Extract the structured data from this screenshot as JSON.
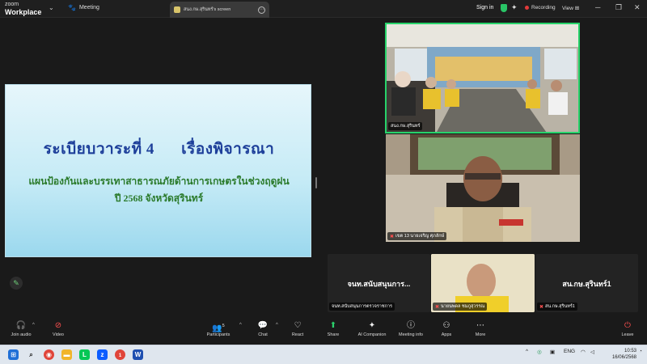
{
  "window": {
    "logo_top": "zoom",
    "logo_bottom": "Workplace",
    "meeting_tab": "Meeting",
    "share_tab": "สนง.กษ.สุรินทร์'s screen",
    "sign_in": "Sign in",
    "recording": "Recording",
    "view": "View",
    "accent": "#27d36a"
  },
  "slide": {
    "title_left": "ระเบียบวาระที่ 4",
    "title_right": "เรื่องพิจารณา",
    "line1": "แผนป้องกันและบรรเทาสาธารณภัยด้านการเกษตรในช่วงฤดูฝน",
    "line2": "ปี 2568  จังหวัดสุรินทร์"
  },
  "videos": {
    "v1_label": "สนง.กษ.สุรินทร์",
    "v2_label": "เขต 13 นายเจริญ ศุภลักษ์",
    "tile1_name": "จนท.สนับสนุนการ...",
    "tile1_label": "จนท.สนับสนุนการตรวจราชการ",
    "tile2_label": "นายนพดล ชมภูสุวรรณ",
    "tile3_name": "สน.กษ.สุรินทร์1",
    "tile3_label": "สน.กษ.สุรินทร์1"
  },
  "toolbar": {
    "join_audio": "Join audio",
    "video": "Video",
    "participants": "Participants",
    "participants_count": "5",
    "chat": "Chat",
    "react": "React",
    "share": "Share",
    "ai_companion": "AI Companion",
    "meeting_info": "Meeting info",
    "apps": "Apps",
    "more": "More",
    "leave": "Leave"
  },
  "taskbar": {
    "lang": "ENG",
    "time": "10:53",
    "date": "16/06/2568",
    "chrome_badge": "1"
  }
}
